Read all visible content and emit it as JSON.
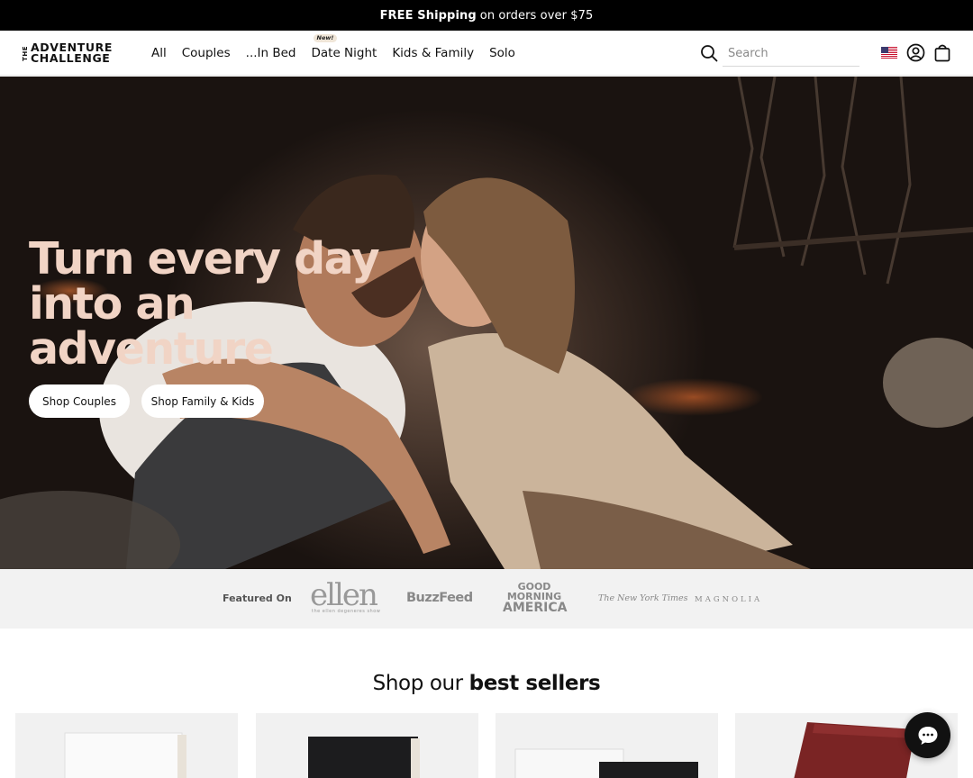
{
  "announcement": {
    "bold": "FREE Shipping",
    "rest": "on orders over $75"
  },
  "header": {
    "logo": {
      "the": "THE",
      "line1": "ADVENTURE",
      "line2": "CHALLENGE"
    },
    "nav": [
      {
        "label": "All"
      },
      {
        "label": "Couples"
      },
      {
        "label": "...In Bed"
      },
      {
        "label": "Date Night",
        "badge": "New!"
      },
      {
        "label": "Kids & Family"
      },
      {
        "label": "Solo"
      }
    ],
    "search": {
      "placeholder": "Search",
      "value": ""
    },
    "icons": {
      "search": "search-icon",
      "flag": "us-flag-icon",
      "account": "account-icon",
      "cart": "cart-icon"
    }
  },
  "hero": {
    "title_lines": [
      "Turn every day",
      "into an",
      "adventure"
    ],
    "buttons": {
      "couples": "Shop Couples",
      "family": "Shop Family & Kids"
    },
    "title_color": "#f1d4c5"
  },
  "featured": {
    "label": "Featured On",
    "press": {
      "ellen": "ellen",
      "ellen_sub": "the ellen degeneres show",
      "buzzfeed": "BuzzFeed",
      "gma_1": "GOOD",
      "gma_2": "MORNING",
      "gma_3": "AMERICA",
      "nyt": "The New York Times",
      "magnolia": "MAGNOLIA"
    }
  },
  "best_sellers": {
    "light": "Shop our ",
    "bold": "best sellers"
  },
  "chat": {
    "icon": "chat-icon"
  }
}
